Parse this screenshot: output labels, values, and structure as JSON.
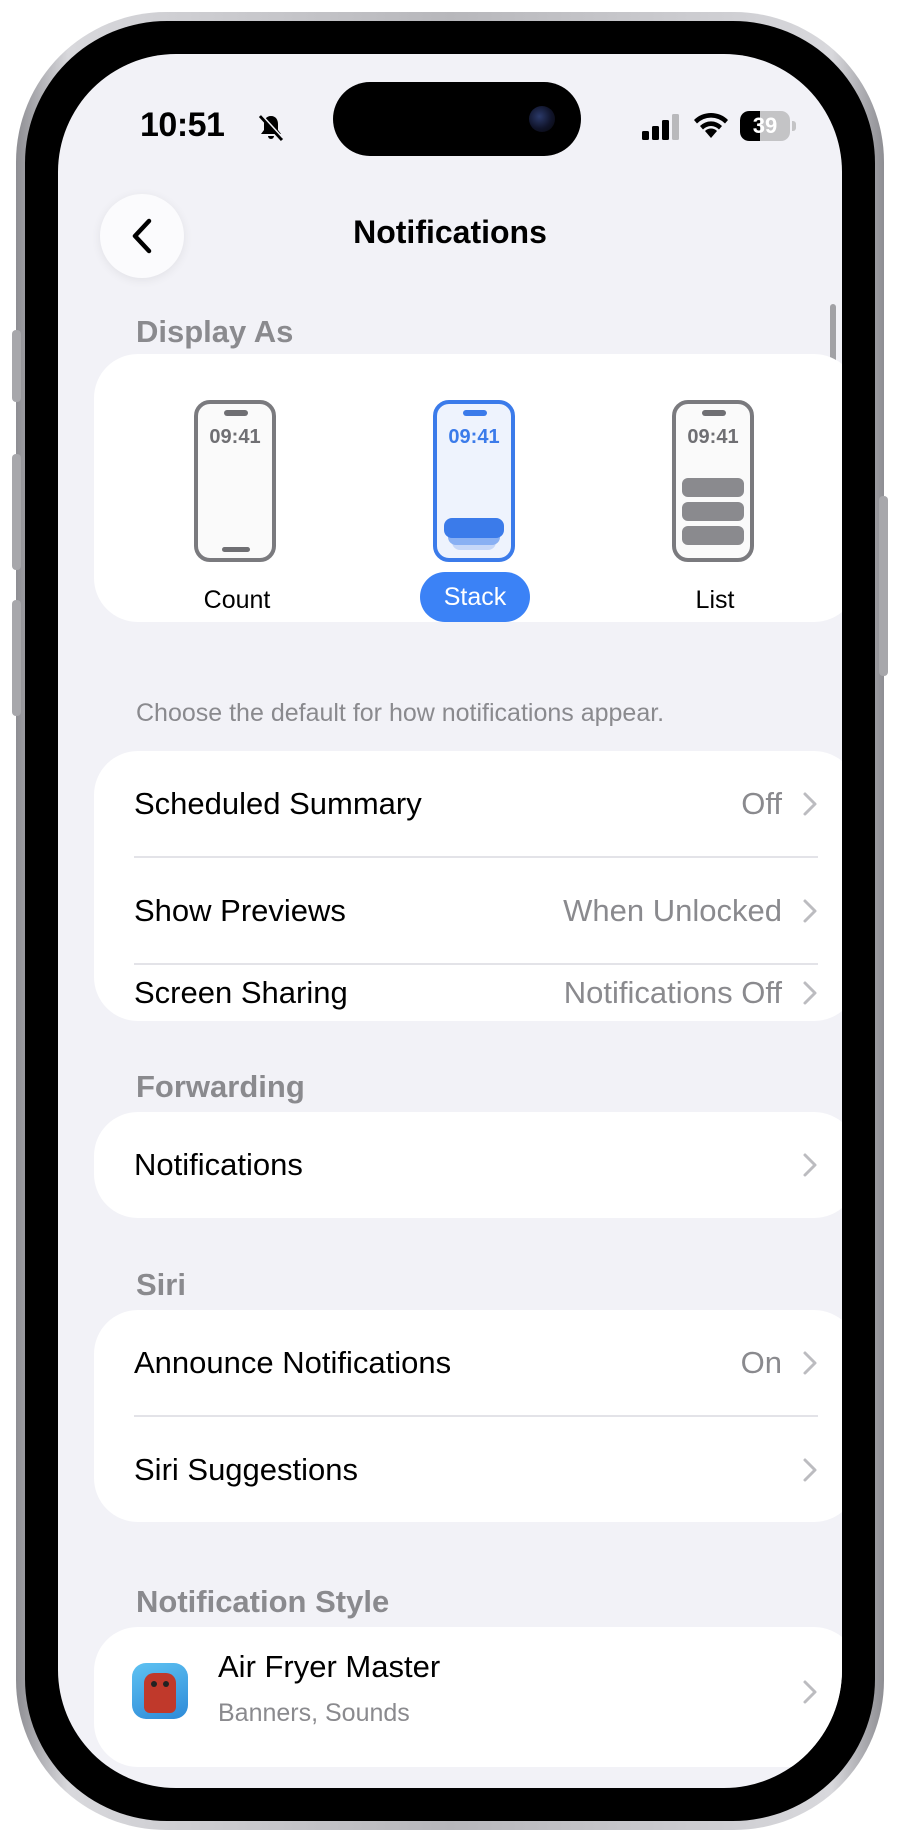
{
  "status_bar": {
    "time": "10:51",
    "battery": "39",
    "battery_level": 0.39
  },
  "nav": {
    "title": "Notifications"
  },
  "display_as": {
    "header": "Display As",
    "options": [
      {
        "label": "Count",
        "preview_time": "09:41",
        "selected": false
      },
      {
        "label": "Stack",
        "preview_time": "09:41",
        "selected": true
      },
      {
        "label": "List",
        "preview_time": "09:41",
        "selected": false
      }
    ],
    "footnote": "Choose the default for how notifications appear."
  },
  "general": {
    "rows": [
      {
        "label": "Scheduled Summary",
        "value": "Off"
      },
      {
        "label": "Show Previews",
        "value": "When Unlocked"
      },
      {
        "label": "Screen Sharing",
        "value": "Notifications Off"
      }
    ]
  },
  "forwarding": {
    "header": "Forwarding",
    "rows": [
      {
        "label": "Notifications",
        "value": ""
      }
    ]
  },
  "siri": {
    "header": "Siri",
    "rows": [
      {
        "label": "Announce Notifications",
        "value": "On"
      },
      {
        "label": "Siri Suggestions",
        "value": ""
      }
    ]
  },
  "notification_style": {
    "header": "Notification Style",
    "apps": [
      {
        "name": "Air Fryer Master",
        "subtitle": "Banners, Sounds"
      }
    ]
  },
  "colors": {
    "accent": "#3b82f6",
    "background": "#f2f2f7",
    "secondary_text": "#8a8a8e"
  },
  "icons": {
    "back": "chevron-left-icon",
    "silent": "bell-slash-icon",
    "signal": "cellular-signal-icon",
    "wifi": "wifi-icon",
    "battery": "battery-icon",
    "row_chevron": "chevron-right-icon"
  }
}
